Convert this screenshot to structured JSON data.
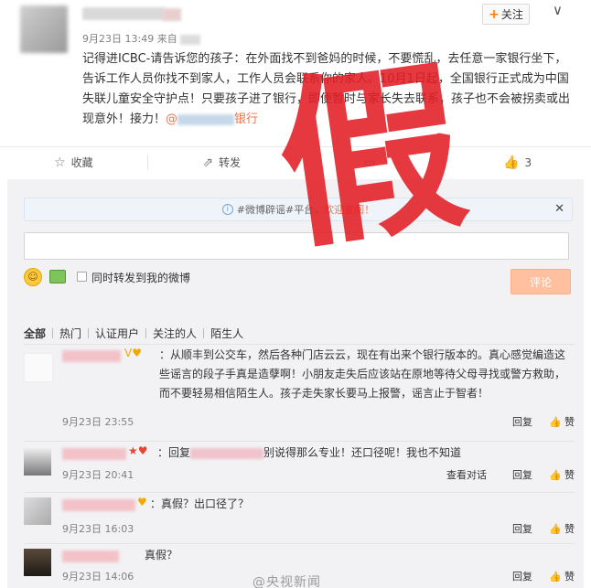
{
  "post": {
    "follow_label": "关注",
    "date": "9月23日 13:49",
    "from_label": "来自",
    "text_part1": "记得进ICBC-请告诉您的孩子：在外面找不到爸妈的时候，不要慌乱，去任意一家银行坐下，告诉工作人员你找不到家人，工作人员会联系你的家人。10月1日起，全国银行正式成为中国失联儿童安全守护点！只要孩子进了银行，即便暂时与家长失去联系，孩子也不会被拐卖或出现意外！接力！",
    "mention_prefix": "@",
    "mention_suffix": "银行",
    "stamp": "假"
  },
  "actions": {
    "favorite_label": "收藏",
    "repost_label": "转发",
    "like_count": "3"
  },
  "comment_box": {
    "notice_text_1": "#微博辟谣#平台，",
    "notice_text_2": "欢迎查阅！",
    "repost_checkbox_label": "同时转发到我的微博",
    "submit_label": "评论"
  },
  "filter_tabs": [
    "全部",
    "热门",
    "认证用户",
    "关注的人",
    "陌生人"
  ],
  "comments": [
    {
      "text": "：从顺丰到公交车，然后各种门店云云，现在有出来个银行版本的。真心感觉编造这些谣言的段子手真是造孽啊！小朋友走失后应该站在原地等待父母寻找或警方救助，而不要轻易相信陌生人。孩子走失家长要马上报警，谣言止于智者！",
      "date": "9月23日 23:55",
      "reply_label": "回复",
      "like_label": "赞"
    },
    {
      "text_prefix": "：回复",
      "text_suffix": "别说得那么专业！还口径呢！我也不知道",
      "date": "9月23日 20:41",
      "conversation_label": "查看对话",
      "reply_label": "回复",
      "like_label": "赞"
    },
    {
      "text": "：真假？出口径了？",
      "date": "9月23日 16:03",
      "reply_label": "回复",
      "like_label": "赞"
    },
    {
      "text": "真假？",
      "date": "9月23日 14:06",
      "reply_label": "回复",
      "like_label": "赞"
    }
  ],
  "watermark": "@央视新闻"
}
